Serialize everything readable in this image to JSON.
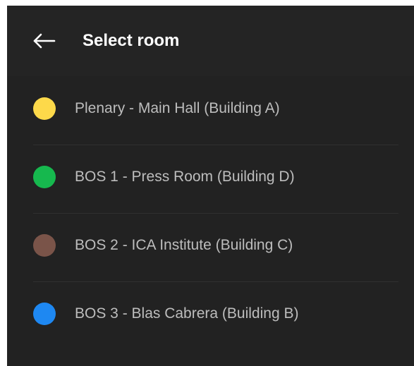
{
  "header": {
    "title": "Select room",
    "back_icon": "arrow-left-icon"
  },
  "rooms": [
    {
      "label": "Plenary - Main Hall (Building A)",
      "color": "#FDD94A"
    },
    {
      "label": "BOS 1 - Press Room (Building D)",
      "color": "#16B84E"
    },
    {
      "label": "BOS 2 - ICA Institute (Building C)",
      "color": "#7A5449"
    },
    {
      "label": "BOS 3 - Blas Cabrera (Building B)",
      "color": "#1E88F2"
    }
  ]
}
